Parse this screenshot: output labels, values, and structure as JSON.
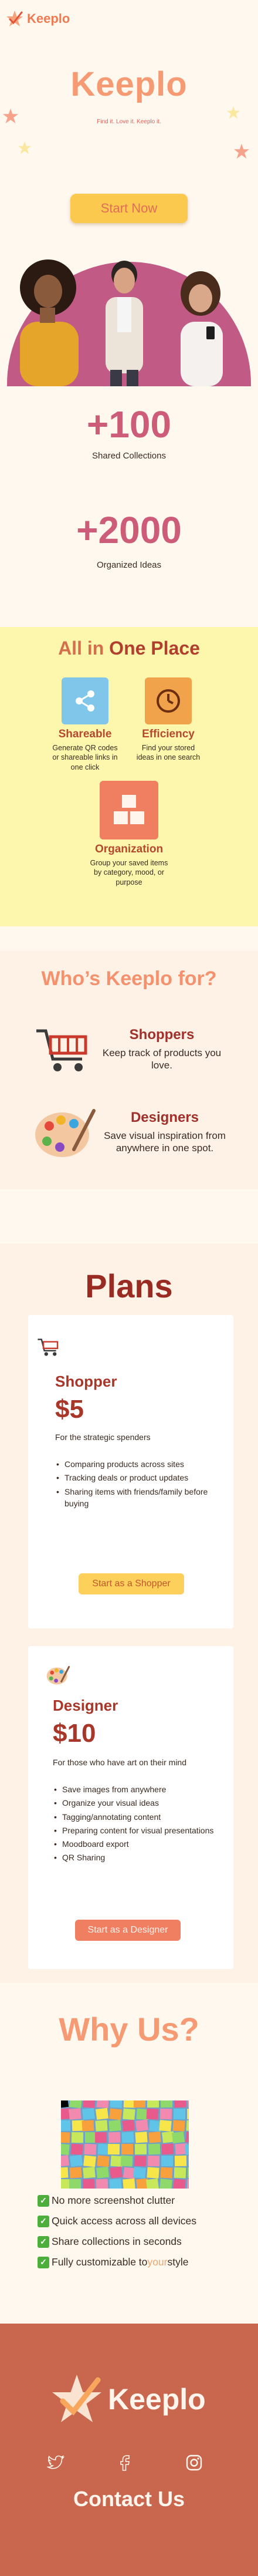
{
  "header": {
    "brand": "Keeplo"
  },
  "hero": {
    "title": "Keeplo",
    "tagline": "Find it. Love it. Keeplo it.",
    "cta_label": "Start Now"
  },
  "stats": [
    {
      "number": "+100",
      "label": "Shared Collections"
    },
    {
      "number": "+2000",
      "label": "Organized Ideas"
    }
  ],
  "features": {
    "title_part1": "All in",
    "title_part2": "One Place",
    "items": [
      {
        "name": "Shareable",
        "desc": "Generate QR codes or shareable links in one click",
        "icon": "share-icon",
        "color": "#7fc6ea"
      },
      {
        "name": "Efficiency",
        "desc": "Find your stored ideas in one search",
        "icon": "clock-icon",
        "color": "#f0a34a"
      },
      {
        "name": "Organization",
        "desc": "Group your saved items by category, mood, or purpose",
        "icon": "boxes-icon",
        "color": "#f07e61"
      }
    ]
  },
  "who": {
    "title": "Who’s Keeplo for?",
    "items": [
      {
        "name": "Shoppers",
        "desc": "Keep track of products you love.",
        "icon": "shopping-cart-icon"
      },
      {
        "name": "Designers",
        "desc": "Save visual inspiration from anywhere in one spot.",
        "icon": "palette-icon"
      }
    ]
  },
  "plans": {
    "title": "Plans",
    "items": [
      {
        "name": "Shopper",
        "price": "$5",
        "subtitle": "For the strategic spenders",
        "features": [
          "Comparing products across sites",
          "Tracking deals or product updates",
          "Sharing items with friends/family before buying"
        ],
        "button": "Start as a Shopper",
        "button_color": "#fcd05a",
        "button_text_color": "#c0582c"
      },
      {
        "name": "Designer",
        "price": "$10",
        "subtitle": "For those who have art on their mind",
        "features": [
          "Save images from anywhere",
          "Organize your visual ideas",
          "Tagging/annotating content",
          "Preparing content for visual presentations",
          "Moodboard export",
          "QR Sharing"
        ],
        "button": "Start as a Designer",
        "button_color": "#f07e61",
        "button_text_color": "#fff2ea"
      }
    ]
  },
  "why": {
    "title": "Why Us?",
    "items": [
      {
        "text": "No more screenshot clutter"
      },
      {
        "text": "Quick access across all devices"
      },
      {
        "text": "Share collections in seconds"
      },
      {
        "text_before": "Fully customizable to ",
        "highlight": "your",
        "text_after": " style"
      }
    ]
  },
  "footer": {
    "brand": "Keeplo",
    "socials": [
      "twitter-icon",
      "facebook-icon",
      "instagram-icon"
    ],
    "contact": "Contact Us"
  },
  "colors": {
    "primary": "#f07a52",
    "cream": "#fff8ef",
    "yellow": "#fdf7ae",
    "footer": "#c8674e"
  }
}
